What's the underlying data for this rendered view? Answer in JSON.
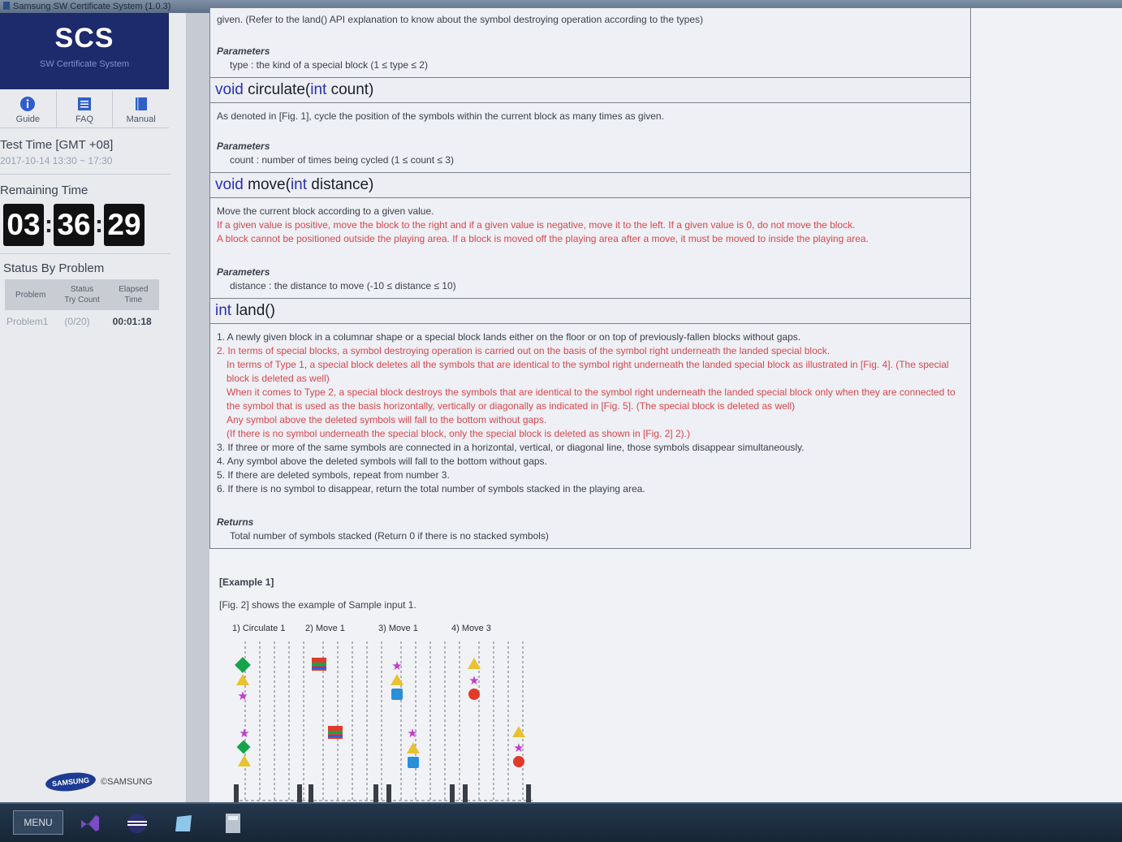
{
  "window": {
    "title": "Samsung SW Certificate System (1.0.3)"
  },
  "sidebar": {
    "logo": "SCS",
    "logo_sub": "SW Certificate System",
    "nav": [
      {
        "label": "Guide",
        "icon": "info-icon"
      },
      {
        "label": "FAQ",
        "icon": "faq-icon"
      },
      {
        "label": "Manual",
        "icon": "book-icon"
      }
    ],
    "test_time_label": "Test Time [GMT +08]",
    "test_time_value": "2017-10-14 13:30 ~ 17:30",
    "remaining_label": "Remaining Time",
    "remaining": {
      "hh": "03",
      "mm": "36",
      "ss": "29"
    },
    "status_label": "Status By Problem",
    "status_headers": {
      "problem": "Problem",
      "status": "Status\nTry Count",
      "elapsed": "Elapsed\nTime"
    },
    "status_row": {
      "problem": "Problem1",
      "count": "(0/20)",
      "elapsed": "00:01:18"
    },
    "brand": "SAMSUNG",
    "copyright": "©SAMSUNG"
  },
  "doc": {
    "top": {
      "line": "given. (Refer to the land() API explanation to know about the symbol destroying operation according to the types)",
      "param_label": "Parameters",
      "param": "type : the kind of a special block (1 ≤ type ≤ 2)"
    },
    "circulate": {
      "kw1": "void",
      "name": " circulate(",
      "kw2": "int",
      "rest": " count)",
      "desc": "As denoted in [Fig. 1], cycle the position of the symbols within the current block as many times as given.",
      "param_label": "Parameters",
      "param": "count : number of times being cycled (1 ≤ count ≤ 3)"
    },
    "move": {
      "kw1": "void",
      "name": " move(",
      "kw2": "int",
      "rest": " distance)",
      "desc1": "Move the current block according to a given value.",
      "desc2": "If a given value is positive, move the block to the right and if a given value is negative, move it to the left. If a given value is 0, do not move the block.",
      "desc3": "A block cannot be positioned outside the playing area. If a block is moved off the playing area after a move, it must be moved to inside the playing area.",
      "param_label": "Parameters",
      "param": "distance : the distance to move (-10 ≤ distance ≤ 10)"
    },
    "land": {
      "kw1": "int",
      "name": " land()",
      "l1": "1. A newly given block in a columnar shape or a special block lands either on the floor or on top of previously-fallen blocks without gaps.",
      "l2": "2. In terms of special blocks, a symbol destroying operation is carried out on the basis of the symbol right underneath the landed special block.",
      "l2a": "In terms of Type 1, a special block deletes all the symbols that are identical to the symbol right underneath the landed special block as illustrated in [Fig. 4]. (The special block is deleted as well)",
      "l2b": "When it comes to Type 2, a special block destroys the symbols that are identical to the symbol right underneath the landed special block only when they are connected to the symbol that is used as the basis horizontally, vertically or diagonally as indicated in [Fig. 5]. (The special block is deleted as well)",
      "l2c": "Any symbol above the deleted symbols will fall to the bottom without gaps.",
      "l2d": "(If there is no symbol underneath the special block, only the special block is deleted as shown in [Fig. 2] 2).)",
      "l3": "3. If three or more of the same symbols are connected in a horizontal, vertical, or diagonal line, those symbols disappear simultaneously.",
      "l4": "4. Any symbol above the deleted symbols will fall to the bottom without gaps.",
      "l5": "5. If there are deleted symbols, repeat from number 3.",
      "l6": "6. If there is no symbol to disappear, return the total number of symbols stacked in the playing area.",
      "returns_label": "Returns",
      "returns": "Total number of symbols stacked (Return 0 if there is no stacked symbols)"
    }
  },
  "example": {
    "heading": "[Example 1]",
    "desc": "[Fig. 2] shows the example of Sample input 1.",
    "steps": [
      "1) Circulate 1",
      "2) Move 1",
      "3) Move 1",
      "4) Move 3"
    ]
  },
  "taskbar": {
    "menu": "MENU"
  },
  "colors": {
    "keyword": "#2a2fb5",
    "highlight_text": "#d8474d",
    "logo_bg": "#1d2a6b"
  }
}
